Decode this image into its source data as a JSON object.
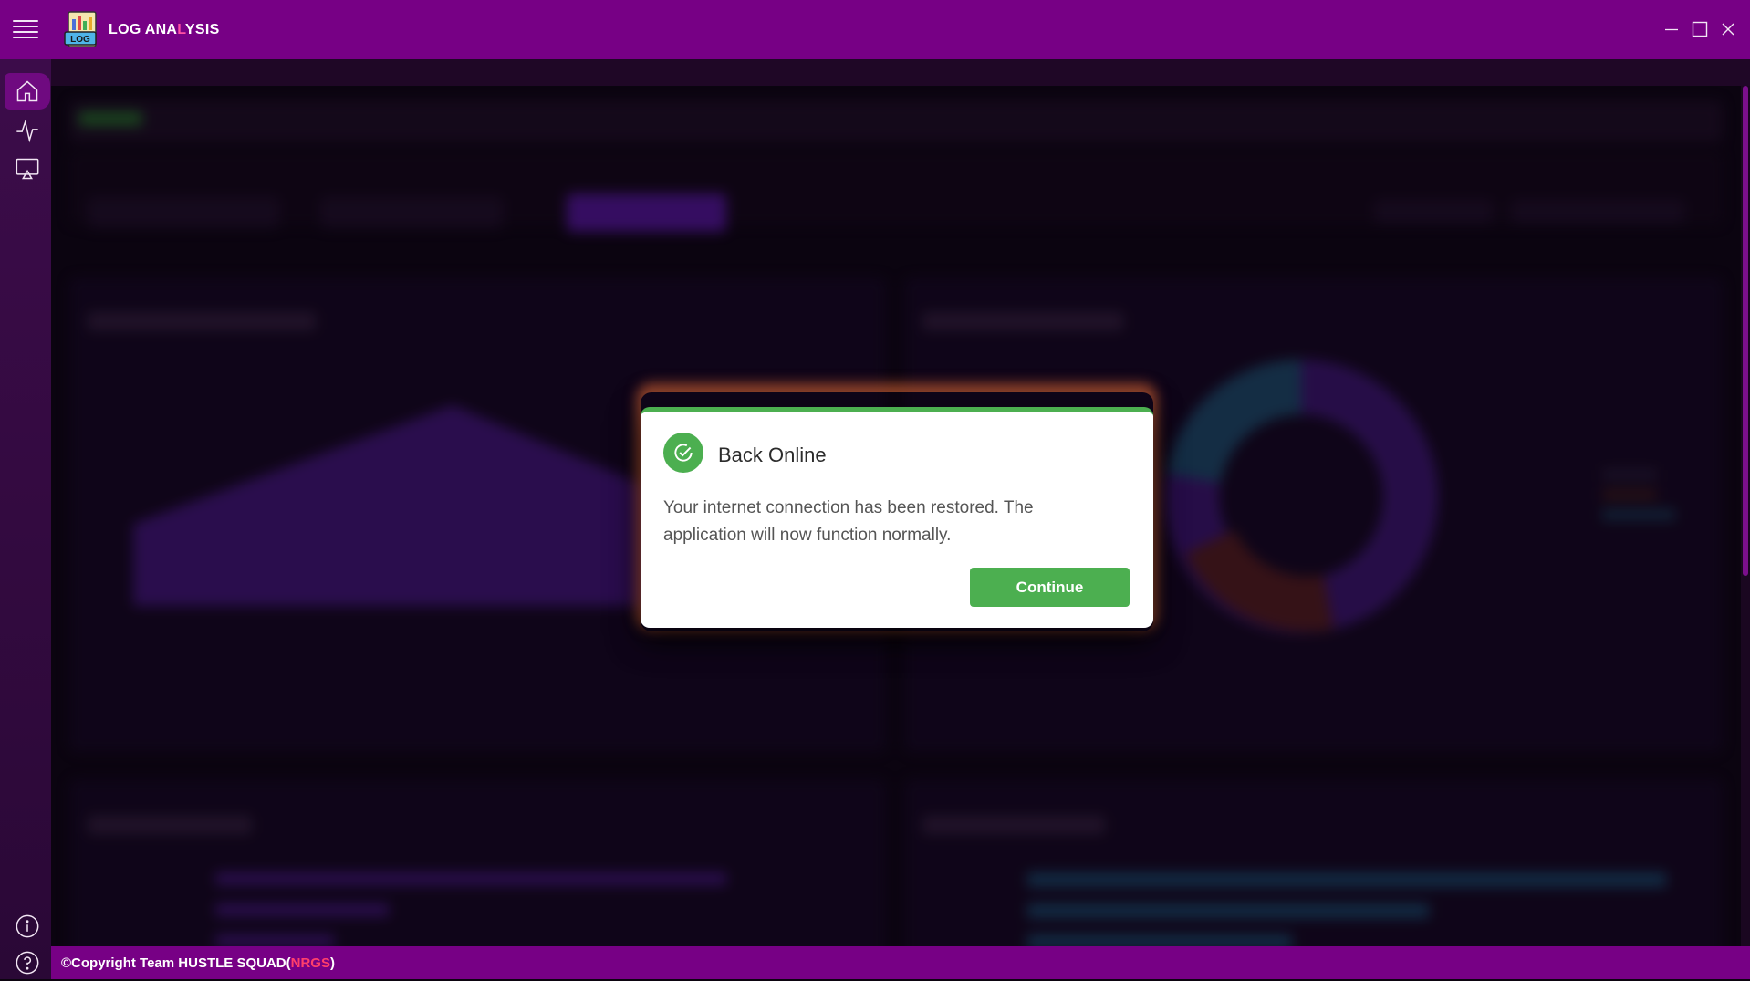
{
  "app": {
    "title_main": "LOG ANA",
    "title_dim": "L",
    "title_rest": "YSIS",
    "logo_text": "LOG"
  },
  "window_controls": [
    "minimize",
    "maximize",
    "close"
  ],
  "sidebar": {
    "items": [
      {
        "icon": "home-icon",
        "active": true
      },
      {
        "icon": "activity-icon",
        "active": false
      },
      {
        "icon": "presentation-icon",
        "active": false
      }
    ],
    "bottom_items": [
      {
        "icon": "info-icon"
      },
      {
        "icon": "help-icon"
      }
    ]
  },
  "modal": {
    "title": "Back Online",
    "message": "Your internet connection has been restored. The application will now function normally.",
    "button_label": "Continue",
    "accent_color": "#4caf50"
  },
  "footer": {
    "text": "©Copyright Team HUSTLE SQUAD(",
    "highlight": "NRGS",
    "close": ")"
  },
  "colors": {
    "brand": "#770085",
    "sidebar": "#3c0c4a",
    "background": "#0b0410",
    "success": "#4caf50",
    "footer_highlight": "#ff3f6b"
  }
}
